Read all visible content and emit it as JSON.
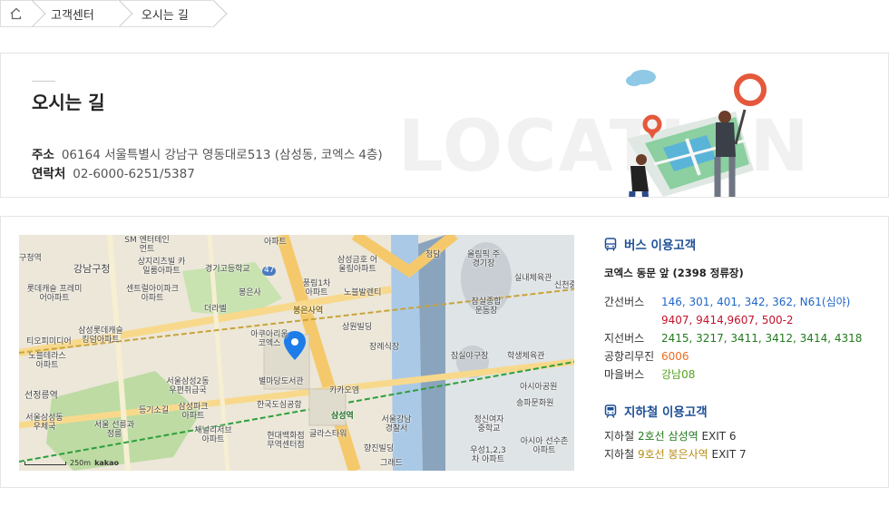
{
  "breadcrumb": {
    "items": [
      "고객센터",
      "오시는 길"
    ]
  },
  "header": {
    "title": "오시는 길",
    "watermark": "LOCATION",
    "address_label": "주소",
    "address": "06164 서울특별시 강남구 영동대로513 (삼성동, 코엑스 4층)",
    "contact_label": "연락처",
    "contact": "02-6000-6251/5387"
  },
  "map": {
    "provider": "kakao",
    "scale": "250m",
    "labels": [
      "구청역",
      "강남구청",
      "SM 엔터테인먼트",
      "상지리츠빌 카일룸아파트",
      "경기고등학교",
      "아파트",
      "롯데캐슬 프레미어아파트",
      "센트럴아이파크 아파트",
      "봉은사",
      "풍림1차 아파트",
      "노블발렌티",
      "삼성금호 어울림아파트",
      "청담",
      "올림픽 주경기장",
      "잠실종합 운동장",
      "실내체육관",
      "신천중",
      "더라벨",
      "봉은사역",
      "상원빌딩",
      "아쿠아리움 코엑스",
      "장례식장",
      "삼성롯데캐슬 킹덤아파트",
      "티오피미디어",
      "노블테라스 아파트",
      "별마당도서관",
      "한국도심공항",
      "카카오엠",
      "잠실야구장",
      "학생체육관",
      "아시아공원",
      "송파문화원",
      "선정릉역",
      "등기소길",
      "서울삼성2동 우편취급국",
      "삼성파크 아파트",
      "서울삼성동 우체국",
      "서울 선릉과정릉",
      "채널리저브 아파트",
      "현대백화점 무역센터점",
      "글라스타워",
      "서울강남 경찰서",
      "향진빌딩",
      "정신여자 중학교",
      "아시아 선수촌아파트",
      "우성1,2,3차 아파트",
      "삼성역",
      "그래드",
      "47"
    ]
  },
  "bus": {
    "title": "버스 이용고객",
    "stop": "코엑스 동문 앞 (2398 정류장)",
    "routes": [
      {
        "type": "간선버스",
        "numbers": "146, 301, 401, 342, 362, N61(심야)",
        "color": "#1f66c9"
      },
      {
        "type": "",
        "numbers": "9407, 9414,9607, 500-2",
        "color": "#c3132c"
      },
      {
        "type": "지선버스",
        "numbers": "2415, 3217, 3411, 3412, 3414, 4318",
        "color": "#217a1d"
      },
      {
        "type": "공항리무진",
        "numbers": "6006",
        "color": "#f06c1b"
      },
      {
        "type": "마을버스",
        "numbers": "강남08",
        "color": "#55a51f"
      }
    ]
  },
  "subway": {
    "title": "지하철 이용고객",
    "rows": [
      {
        "prefix": "지하철",
        "line": "2호선 삼성역",
        "exit": "EXIT 6",
        "color": "#217a1d"
      },
      {
        "prefix": "지하철",
        "line": "9호선 봉은사역",
        "exit": "EXIT 7",
        "color": "#b68d16"
      }
    ]
  }
}
